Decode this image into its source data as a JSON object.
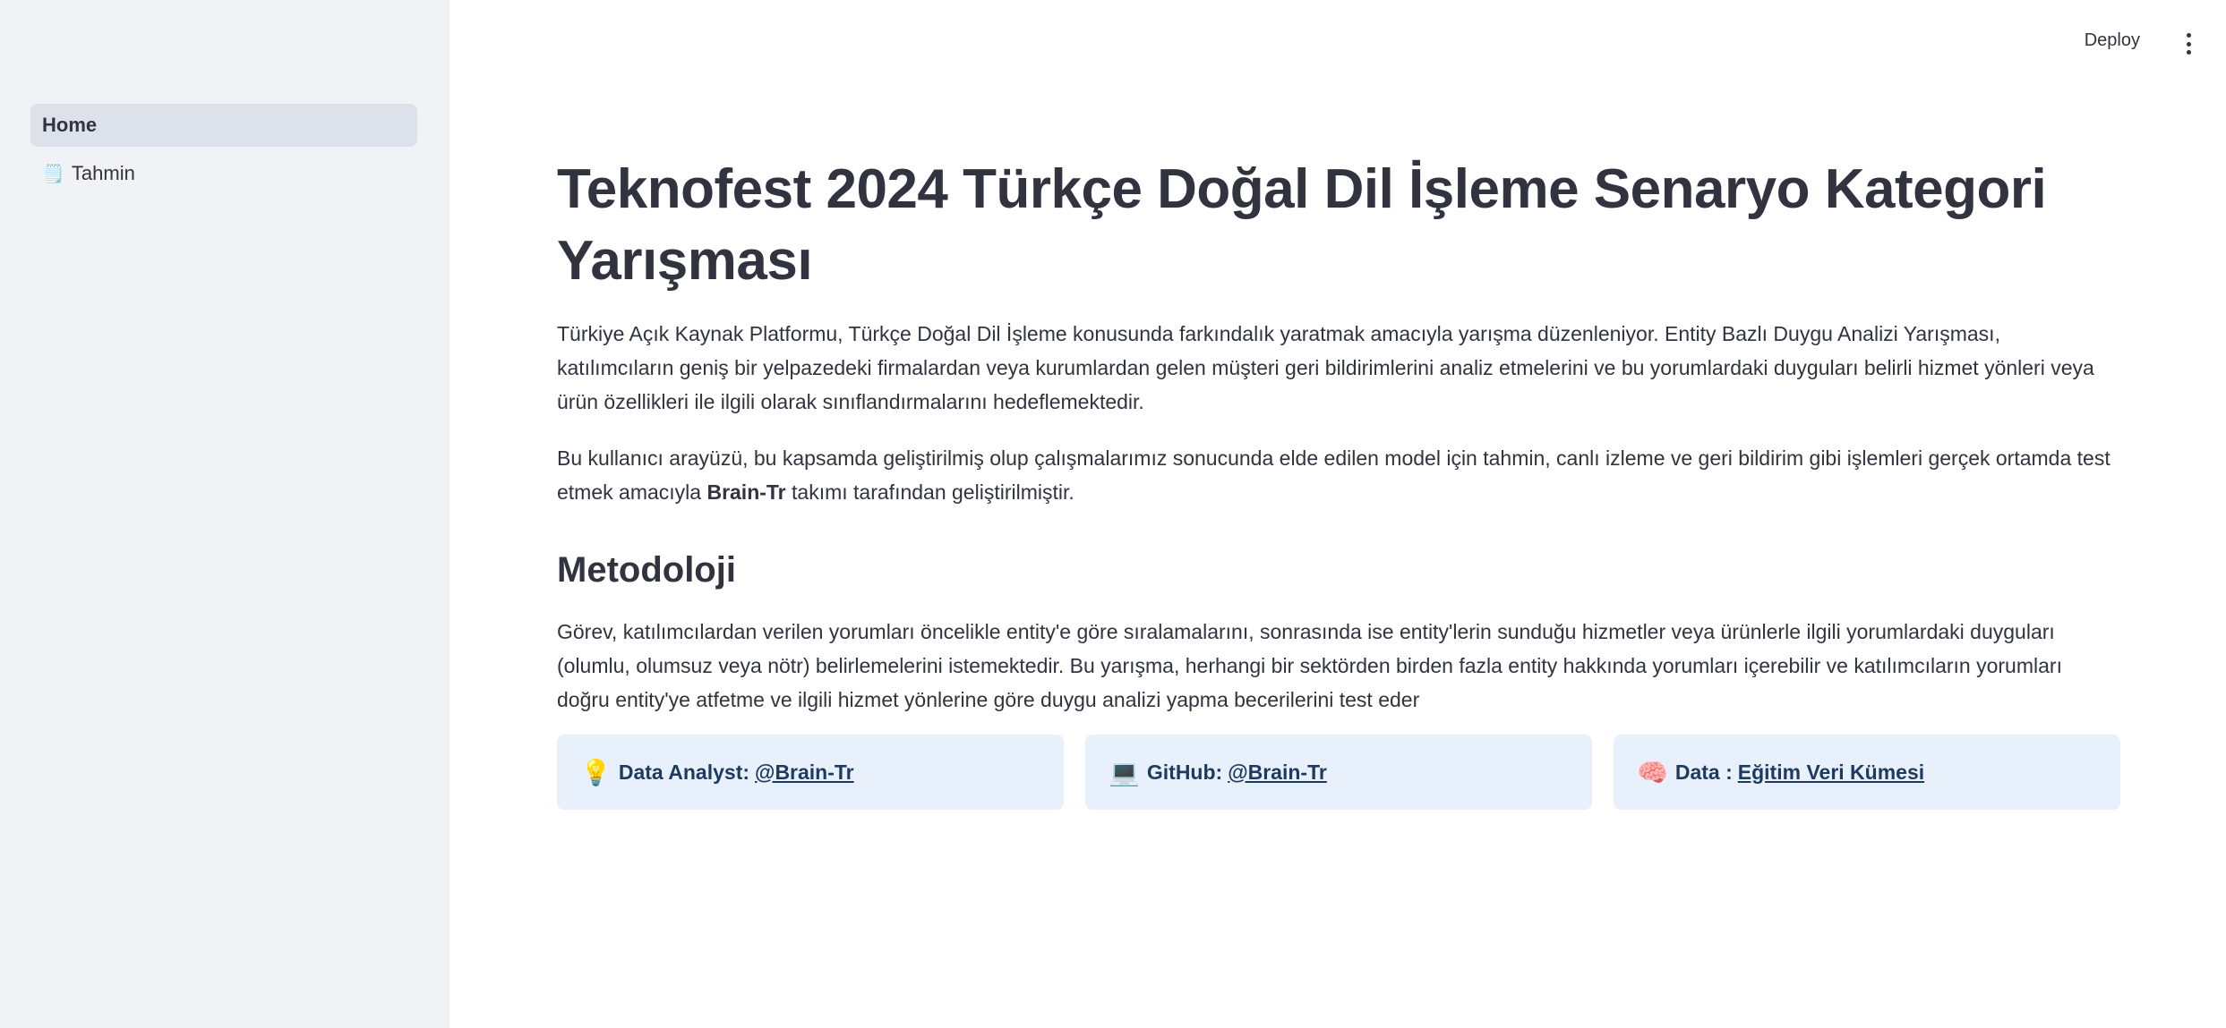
{
  "sidebar": {
    "items": [
      {
        "label": "Home",
        "emoji": ""
      },
      {
        "label": "Tahmin",
        "emoji": "🗒️"
      }
    ]
  },
  "header": {
    "deploy_label": "Deploy"
  },
  "main": {
    "title": "Teknofest 2024 Türkçe Doğal Dil İşleme Senaryo Kategori Yarışması",
    "intro": "Türkiye Açık Kaynak Platformu, Türkçe Doğal Dil İşleme konusunda farkındalık yaratmak amacıyla yarışma düzenleniyor. Entity Bazlı Duygu Analizi Yarışması, katılımcıların geniş bir yelpazedeki firmalardan veya kurumlardan gelen müşteri geri bildirimlerini analiz etmelerini ve bu yorumlardaki duyguları belirli hizmet yönleri veya ürün özellikleri ile ilgili olarak sınıflandırmalarını hedeflemektedir.",
    "about_before": "Bu kullanıcı arayüzü, bu kapsamda geliştirilmiş olup çalışmalarımız sonucunda elde edilen model için tahmin, canlı izleme ve geri bildirim gibi işlemleri gerçek ortamda test etmek amacıyla ",
    "about_team": "Brain-Tr",
    "about_after": " takımı tarafından geliştirilmiştir.",
    "section_title": "Metodoloji",
    "methodology": "Görev, katılımcılardan verilen yorumları öncelikle entity'e göre sıralamalarını, sonrasında ise entity'lerin sunduğu hizmetler veya ürünlerle ilgili yorumlardaki duyguları (olumlu, olumsuz veya nötr) belirlemelerini istemektedir. Bu yarışma, herhangi bir sektörden birden fazla entity hakkında yorumları içerebilir ve katılımcıların yorumları doğru entity'ye atfetme ve ilgili hizmet yönlerine göre duygu analizi yapma becerilerini test eder",
    "cards": [
      {
        "emoji": "💡",
        "label": "Data Analyst:",
        "link": "@Brain-Tr"
      },
      {
        "emoji": "💻",
        "label": "GitHub:",
        "link": "@Brain-Tr"
      },
      {
        "emoji": "🧠",
        "label": "Data :",
        "link": "Eğitim Veri Kümesi"
      }
    ]
  },
  "colors": {
    "sidebar_bg": "#f0f2f6",
    "active_nav_bg": "#dde1e9",
    "card_bg": "#e8f0fb",
    "card_text": "#1e3a5f",
    "text": "#31333f"
  }
}
